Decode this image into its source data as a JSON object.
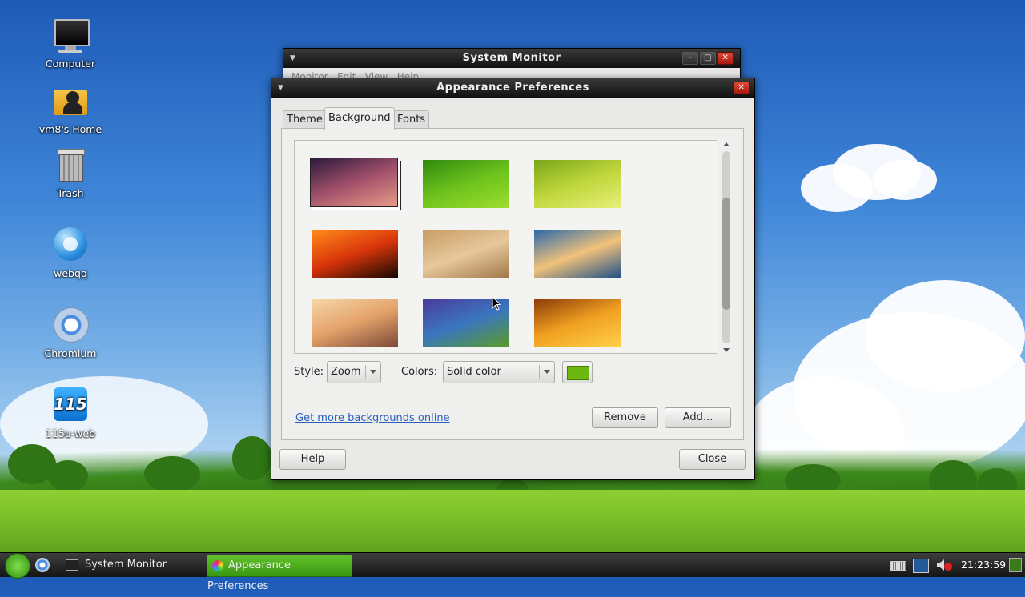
{
  "desktop": {
    "icons": [
      {
        "label": "Computer",
        "icon": "monitor-icon"
      },
      {
        "label": "vm8's Home",
        "icon": "home-folder-icon"
      },
      {
        "label": "Trash",
        "icon": "trash-icon"
      },
      {
        "label": "webqq",
        "icon": "webqq-icon"
      },
      {
        "label": "Chromium",
        "icon": "chromium-icon"
      },
      {
        "label": "115u-web",
        "icon": "115u-web-icon"
      }
    ]
  },
  "system_monitor": {
    "title": "System Monitor",
    "menu": [
      "Monitor",
      "Edit",
      "View",
      "Help"
    ]
  },
  "appearance": {
    "title": "Appearance Preferences",
    "tabs": [
      "Theme",
      "Background",
      "Fonts"
    ],
    "active_tab": "Background",
    "wallpapers": [
      {
        "name": "nebula",
        "colors": [
          "#2b1a3c",
          "#a2506a",
          "#e89a88"
        ]
      },
      {
        "name": "green-leaf",
        "colors": [
          "#2f8a0d",
          "#6dc21d",
          "#9ede2e"
        ]
      },
      {
        "name": "wheat-grass",
        "colors": [
          "#7aa61a",
          "#bfd63b",
          "#e7ef7a"
        ]
      },
      {
        "name": "horse-sunset",
        "colors": [
          "#ff8a1a",
          "#d8340a",
          "#110802"
        ]
      },
      {
        "name": "golden-field",
        "colors": [
          "#c99c66",
          "#e6c89b",
          "#a07649"
        ]
      },
      {
        "name": "lake-mountains",
        "colors": [
          "#2d6aaa",
          "#f1c27a",
          "#1c4f88"
        ]
      },
      {
        "name": "shore-sunrise",
        "colors": [
          "#f5d8a8",
          "#e4a26a",
          "#7c4a38"
        ]
      },
      {
        "name": "blur-purple",
        "colors": [
          "#4b3a9a",
          "#3a76c0",
          "#5a9a2a"
        ]
      },
      {
        "name": "orange-tulip",
        "colors": [
          "#8a3a08",
          "#f0a020",
          "#ffd04a"
        ]
      }
    ],
    "style_label": "Style:",
    "style_value": "Zoom",
    "colors_label": "Colors:",
    "colors_value": "Solid color",
    "swatch_color": "#6cb810",
    "link": "Get more backgrounds online",
    "remove_label": "Remove",
    "add_label": "Add...",
    "help_label": "Help",
    "close_label": "Close"
  },
  "taskbar": {
    "tasks": [
      "System Monitor",
      "Appearance Preferences"
    ],
    "active_task": "Appearance Preferences",
    "clock": "21:23:59",
    "tray_icons": [
      "keyboard-icon",
      "network-icon",
      "volume-icon"
    ]
  }
}
